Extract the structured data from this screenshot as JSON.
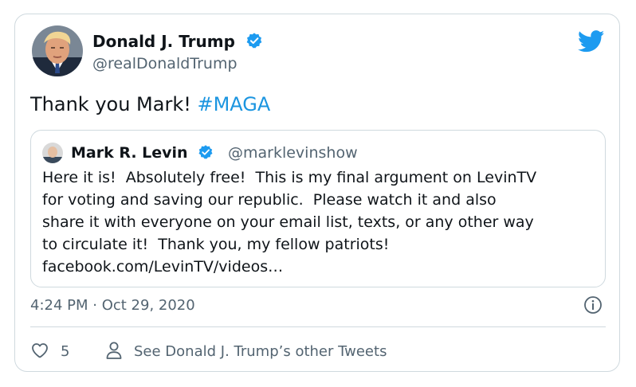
{
  "tweet": {
    "author_name": "Donald J. Trump",
    "author_handle": "@realDonaldTrump",
    "text": "Thank you Mark! ",
    "hashtag": "#MAGA",
    "timestamp": "4:24 PM · Oct 29, 2020",
    "like_count": "5",
    "see_more_label": "See Donald J. Trump’s other Tweets"
  },
  "quoted_tweet": {
    "author_name": "Mark R. Levin",
    "author_handle": "@marklevinshow",
    "lines": [
      "Here it is!  Absolutely free!  This is my final argument on LevinTV",
      "for voting and saving our republic.  Please watch it and also",
      "share it with everyone on your email list, texts, or any other way",
      "to circulate it!  Thank you, my fellow patriots!",
      "facebook.com/LevinTV/videos…"
    ]
  },
  "icons": {
    "verified": "verified-badge-icon",
    "brand": "twitter-bird-icon",
    "info": "info-icon",
    "like": "heart-icon",
    "profile": "person-icon"
  },
  "colors": {
    "accent": "#1d9bf0",
    "hashtag": "#1b95e0",
    "secondary_text": "#536471",
    "border": "#cfd9de"
  }
}
